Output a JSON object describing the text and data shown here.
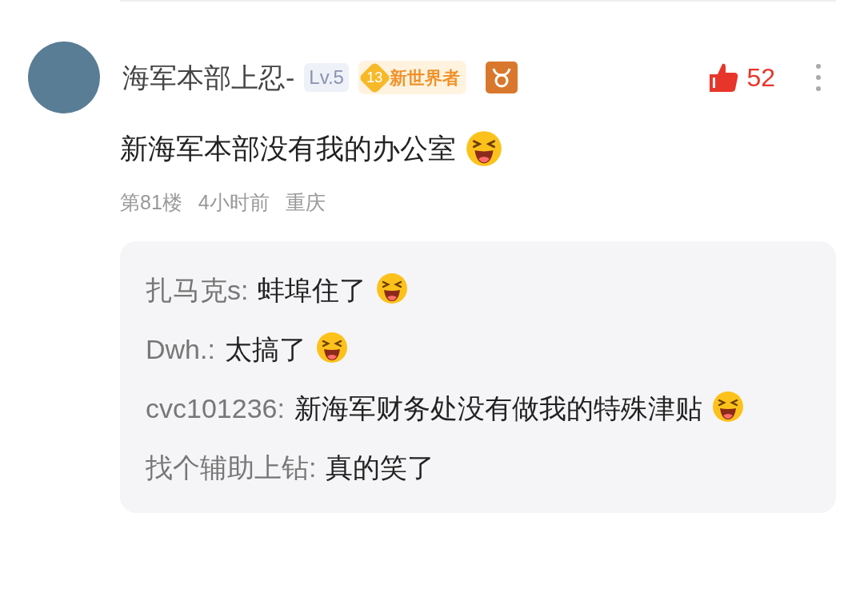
{
  "comment": {
    "author": "海军本部上忍-",
    "level_badge": "Lv.5",
    "fan_badge": {
      "number": "13",
      "label": "新世界者"
    },
    "likes": {
      "count": "52",
      "liked": true
    },
    "text": "新海军本部没有我的办公室",
    "emoji": true,
    "meta": {
      "floor": "第81楼",
      "time": "4小时前",
      "location": "重庆"
    }
  },
  "replies": [
    {
      "author": "扎马克s:",
      "text": "蚌埠住了",
      "emoji": true
    },
    {
      "author": "Dwh.:",
      "text": "太搞了",
      "emoji": true
    },
    {
      "author": "cvc101236:",
      "text": "新海军财务处没有做我的特殊津贴",
      "emoji": true
    },
    {
      "author": "找个辅助上钻:",
      "text": "真的笑了",
      "emoji": false
    }
  ]
}
